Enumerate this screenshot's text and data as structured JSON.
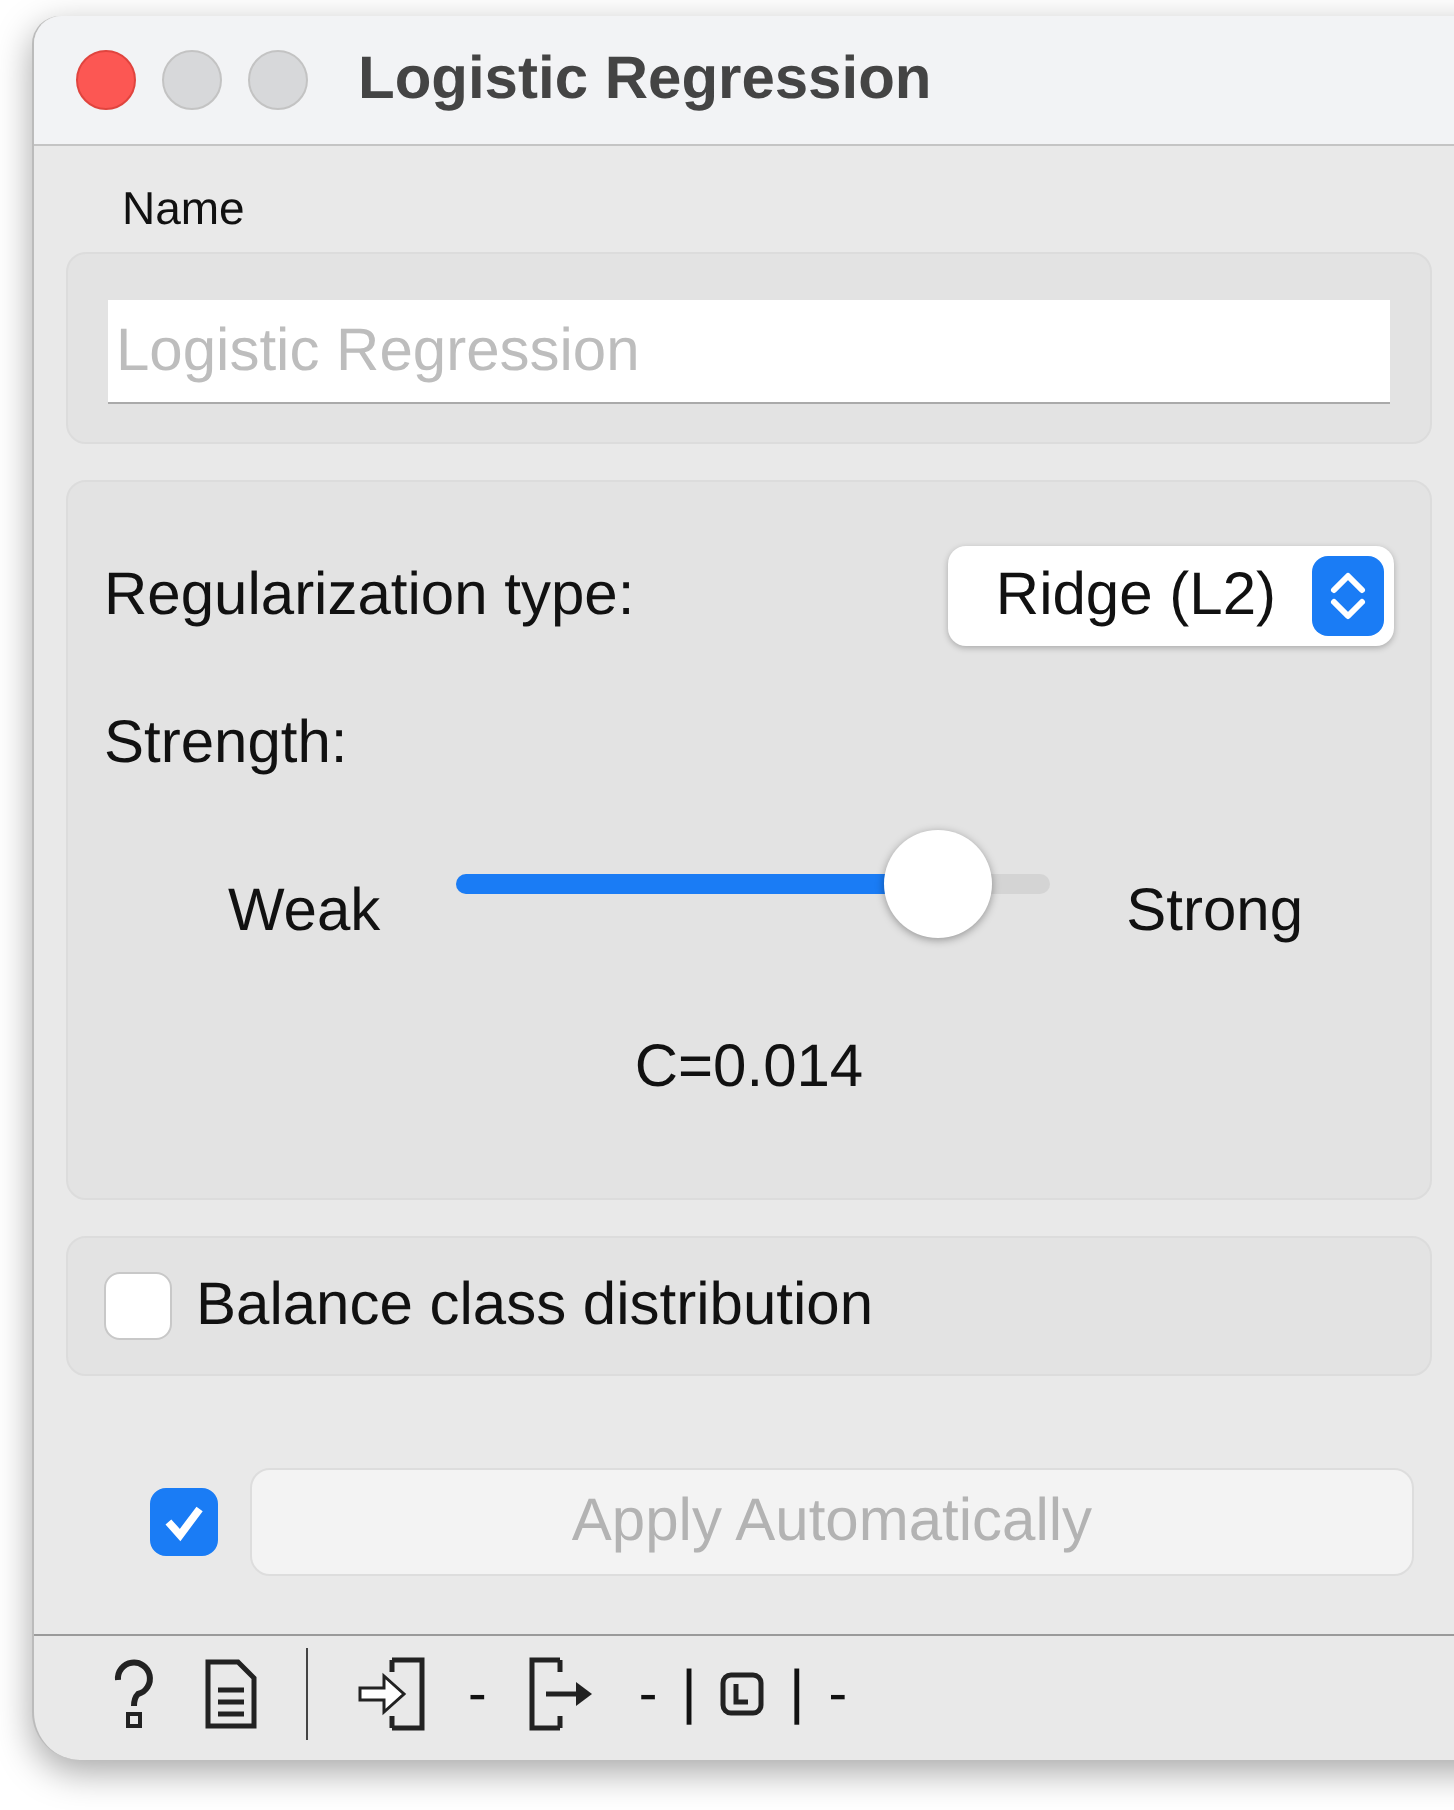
{
  "window": {
    "title": "Logistic Regression"
  },
  "name_box": {
    "label": "Name",
    "placeholder": "Logistic Regression"
  },
  "regularization": {
    "label": "Regularization type:",
    "value": "Ridge (L2)",
    "strength_label": "Strength:",
    "min_label": "Weak",
    "max_label": "Strong",
    "level": 0.81,
    "reading": "C=0.014"
  },
  "balance": {
    "label": "Balance class distribution",
    "checked": false
  },
  "apply": {
    "checked": true,
    "label": "Apply Automatically",
    "disabled": true
  },
  "status_bar": {
    "texts": [
      "-",
      "-",
      "|",
      "|",
      "-"
    ]
  }
}
